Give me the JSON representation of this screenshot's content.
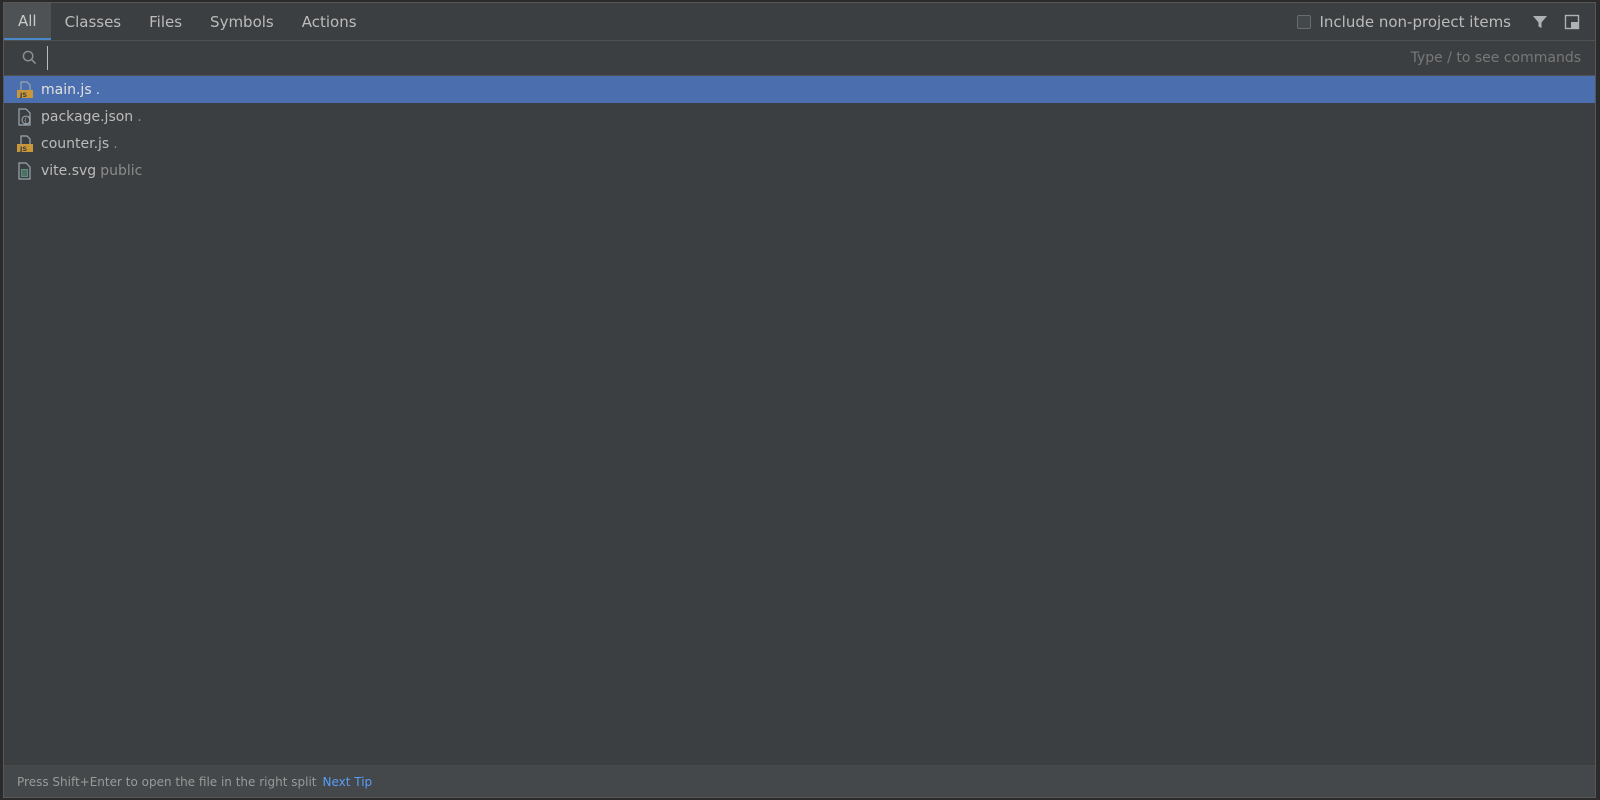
{
  "tabs": [
    {
      "label": "All",
      "active": true
    },
    {
      "label": "Classes",
      "active": false
    },
    {
      "label": "Files",
      "active": false
    },
    {
      "label": "Symbols",
      "active": false
    },
    {
      "label": "Actions",
      "active": false
    }
  ],
  "header": {
    "include_non_project_label": "Include non-project items",
    "include_non_project_checked": false,
    "filter_icon": "filter-icon",
    "preview_icon": "preview-panel-icon"
  },
  "search": {
    "value": "",
    "hint": "Type / to see commands",
    "icon": "search-icon"
  },
  "results": [
    {
      "name": "main.js",
      "location": ".",
      "icon": "js-file-icon",
      "selected": true
    },
    {
      "name": "package.json",
      "location": ".",
      "icon": "json-file-icon",
      "selected": false
    },
    {
      "name": "counter.js",
      "location": ".",
      "icon": "js-file-icon",
      "selected": false
    },
    {
      "name": "vite.svg",
      "location": "public",
      "icon": "svg-file-icon",
      "selected": false
    }
  ],
  "footer": {
    "tip_text": "Press Shift+Enter to open the file in the right split",
    "next_tip_label": "Next Tip"
  },
  "colors": {
    "background": "#3c3f41",
    "selection": "#4b6eaf",
    "link": "#589df6",
    "js_badge": "#c9963a"
  }
}
